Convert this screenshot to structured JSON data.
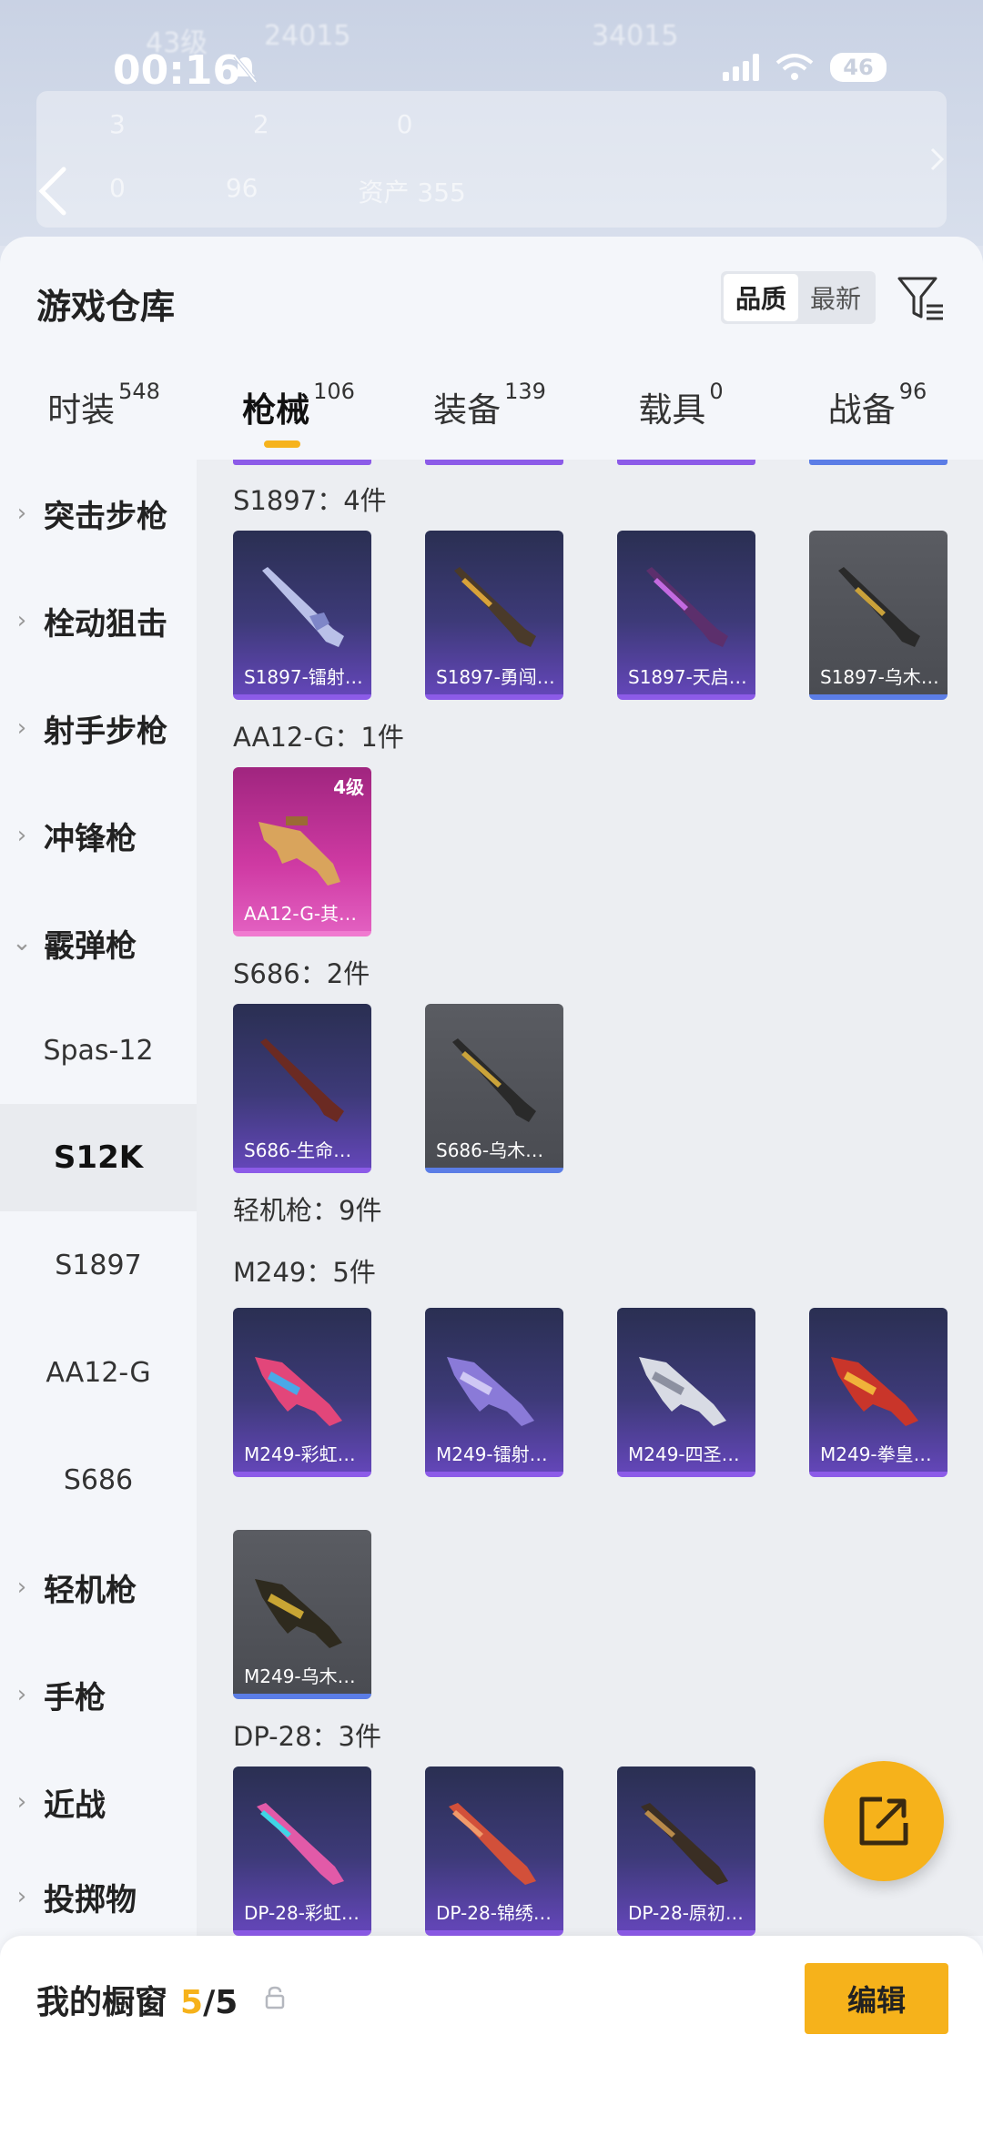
{
  "status_bar": {
    "time": "00:16",
    "battery": "46"
  },
  "backdrop": {
    "level": "43级",
    "coins": "24015",
    "points": "34015",
    "stat_a": "3",
    "stat_b": "2",
    "stat_c": "0",
    "stat_d": "0",
    "stat_e": "96",
    "assets_label": "资产",
    "assets_value": "355"
  },
  "header": {
    "title": "游戏仓库",
    "sort_quality": "品质",
    "sort_newest": "最新"
  },
  "tabs": [
    {
      "label": "时装",
      "count": "548"
    },
    {
      "label": "枪械",
      "count": "106"
    },
    {
      "label": "装备",
      "count": "139"
    },
    {
      "label": "载具",
      "count": "0"
    },
    {
      "label": "战备",
      "count": "96"
    }
  ],
  "categories": {
    "assault": "突击步枪",
    "bolt": "栓动狙击",
    "marksman": "射手步枪",
    "smg": "冲锋枪",
    "shotgun": "霰弹枪",
    "sub_spas": "Spas-12",
    "sub_s12k": "S12K",
    "sub_s1897": "S1897",
    "sub_aa12": "AA12-G",
    "sub_s686": "S686",
    "lmg": "轻机枪",
    "pistol": "手枪",
    "melee": "近战",
    "throwable": "投掷物"
  },
  "groups": {
    "s1897": "S1897：4件",
    "aa12": "AA12-G：1件",
    "s686": "S686：2件",
    "lmg": "轻机枪：9件",
    "m249": "M249：5件",
    "dp28": "DP-28：3件"
  },
  "items": {
    "s1897_1": "S1897-镭射…",
    "s1897_2": "S1897-勇闯…",
    "s1897_3": "S1897-天启…",
    "s1897_4": "S1897-乌木…",
    "aa12_1": "AA12-G-其…",
    "aa12_1_level": "4级",
    "s686_1": "S686-生命…",
    "s686_2": "S686-乌木…",
    "m249_1": "M249-彩虹…",
    "m249_2": "M249-镭射…",
    "m249_3": "M249-四圣…",
    "m249_4": "M249-拳皇…",
    "m249_5": "M249-乌木…",
    "dp28_1": "DP-28-彩虹…",
    "dp28_2": "DP-28-锦绣…",
    "dp28_3": "DP-28-原初…"
  },
  "showcase": {
    "title": "我的橱窗",
    "count": "5",
    "total": "/5",
    "edit_label": "编辑"
  },
  "colors": {
    "accent": "#f6b21b",
    "purple_rarity": "#8c5be8",
    "pink_rarity": "#e25fc0",
    "gray_rarity": "#5b7de6"
  }
}
